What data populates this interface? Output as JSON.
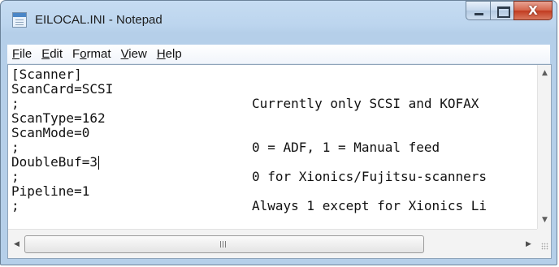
{
  "window": {
    "title": "EILOCAL.INI - Notepad"
  },
  "controls": {
    "close_glyph": "X"
  },
  "menu": [
    {
      "underline": "F",
      "rest": "ile"
    },
    {
      "underline": "E",
      "rest": "dit"
    },
    {
      "pre": "F",
      "underline": "o",
      "rest": "rmat"
    },
    {
      "underline": "V",
      "rest": "iew"
    },
    {
      "underline": "H",
      "rest": "elp"
    }
  ],
  "lines": [
    {
      "left": "[Scanner]",
      "right": ""
    },
    {
      "left": "ScanCard=SCSI",
      "right": ""
    },
    {
      "left": ";",
      "right": "Currently only SCSI and KOFAX"
    },
    {
      "left": "ScanType=162",
      "right": ""
    },
    {
      "left": "ScanMode=0",
      "right": ""
    },
    {
      "left": ";",
      "right": "0 = ADF, 1 = Manual feed"
    },
    {
      "left": "DoubleBuf=3",
      "right": ""
    },
    {
      "left": ";",
      "right": "0 for Xionics/Fujitsu-scanners"
    },
    {
      "left": "Pipeline=1",
      "right": ""
    },
    {
      "left": ";",
      "right": "Always 1 except for Xionics Li"
    }
  ],
  "caret_line": 6,
  "scrollbar": {
    "up": "▲",
    "down": "▼",
    "left": "◀",
    "right": "▶",
    "thumb_grip": "III"
  },
  "colors": {
    "titlebar": "#bcd5ee",
    "close_button": "#c23b20",
    "text": "#111111"
  }
}
